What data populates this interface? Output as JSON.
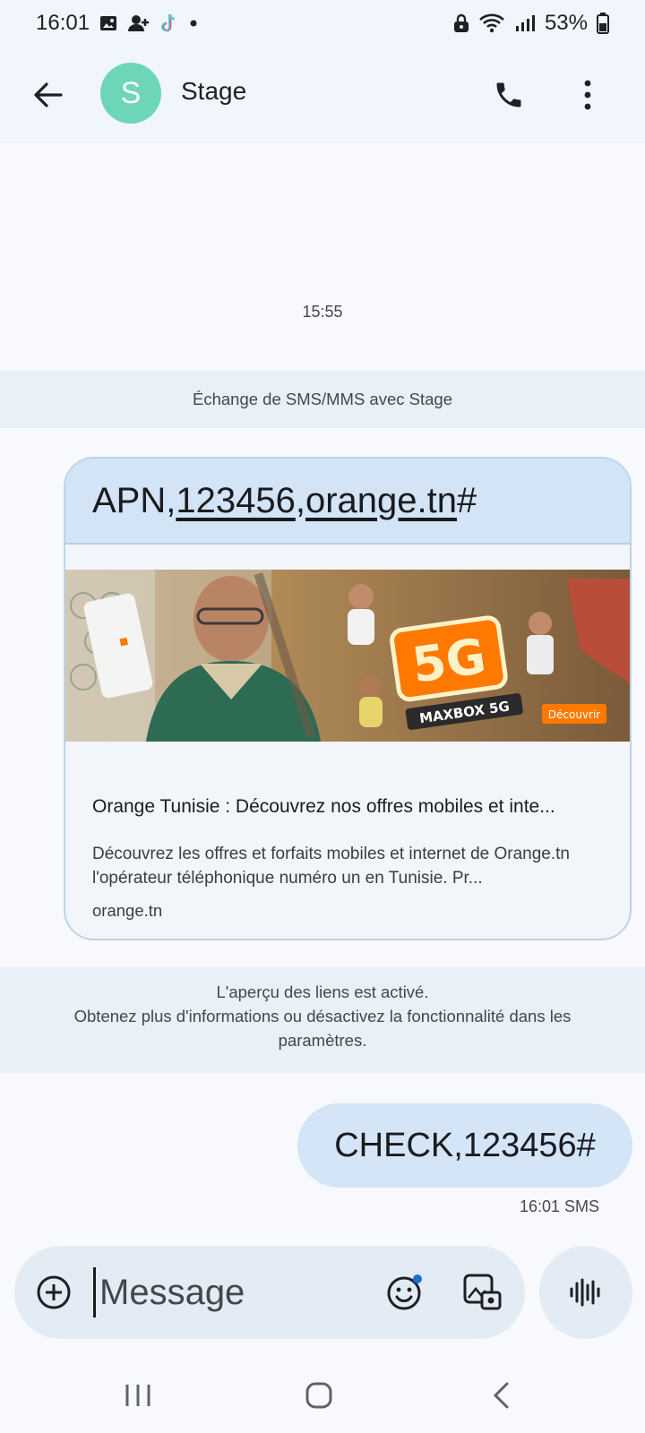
{
  "status_bar": {
    "time": "16:01",
    "battery": "53%"
  },
  "header": {
    "avatar_letter": "S",
    "contact_name": "Stage"
  },
  "conversation": {
    "timestamp": "15:55",
    "exchange_notice": "Échange de SMS/MMS avec Stage",
    "received_message": {
      "parts": [
        "APN,",
        "123456",
        ",",
        "orange.tn",
        "#"
      ],
      "preview": {
        "banner_text_5g": "5G",
        "banner_text_maxbox": "MAXBOX 5G",
        "banner_button": "Découvrir",
        "title": "Orange Tunisie : Découvrez nos offres mobiles et inte...",
        "description": "Découvrez les offres et forfaits mobiles et internet de Orange.tn l'opérateur téléphonique numéro un en Tunisie. Pr...",
        "domain": "orange.tn"
      }
    },
    "link_preview_notice": {
      "line1": "L'aperçu des liens est activé.",
      "line2": "Obtenez plus d'informations ou désactivez la fonctionnalité dans les",
      "line3": "paramètres."
    },
    "sent_message": {
      "text": "CHECK,123456#",
      "meta": "16:01 SMS"
    }
  },
  "composer": {
    "placeholder": "Message"
  },
  "colors": {
    "avatar": "#6dd5b8",
    "bubble": "#d3e5f6",
    "header_bg": "#f0f6fb"
  }
}
